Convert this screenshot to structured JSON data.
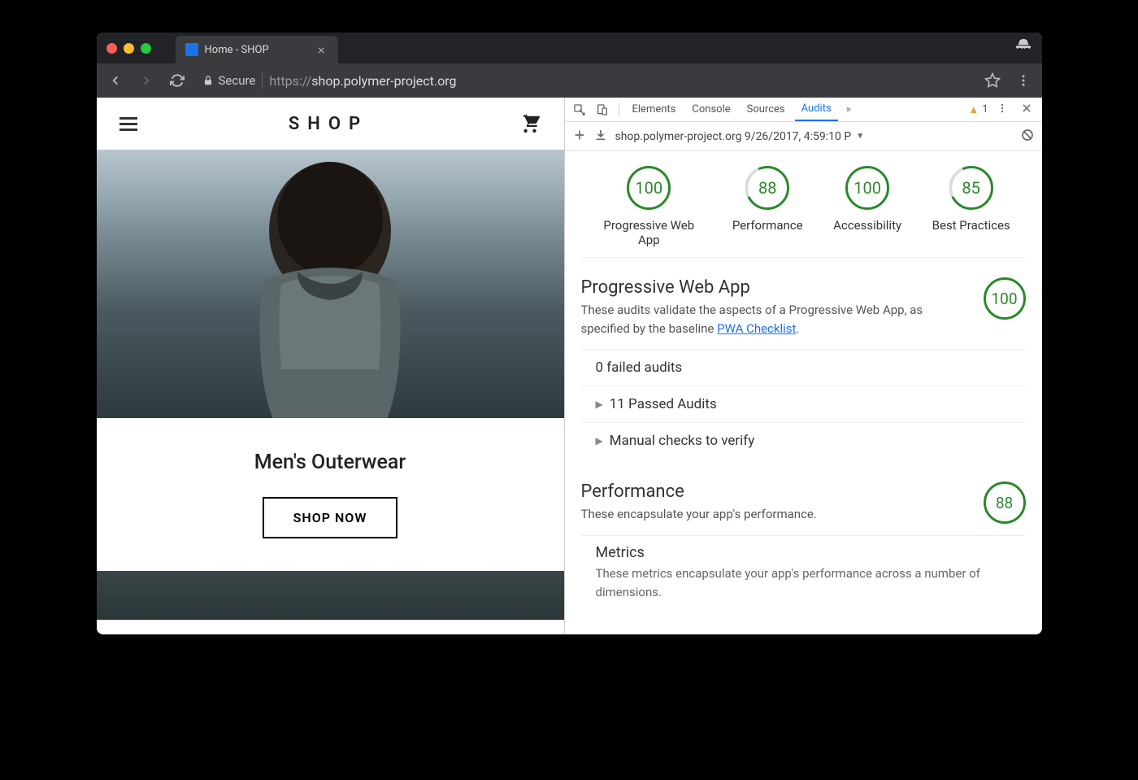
{
  "browser": {
    "tab_title": "Home - SHOP",
    "secure_label": "Secure",
    "url_prefix": "https://",
    "url_host": "shop.polymer-project.org"
  },
  "site": {
    "logo": "SHOP",
    "product_title": "Men's Outerwear",
    "cta": "SHOP NOW"
  },
  "devtools": {
    "tabs": [
      "Elements",
      "Console",
      "Sources",
      "Audits"
    ],
    "active_tab": "Audits",
    "warnings_count": "1",
    "subbar_text": "shop.polymer-project.org 9/26/2017, 4:59:10 P",
    "scores": [
      {
        "value": "100",
        "label": "Progressive Web App",
        "partial": false
      },
      {
        "value": "88",
        "label": "Performance",
        "partial": true
      },
      {
        "value": "100",
        "label": "Accessibility",
        "partial": false
      },
      {
        "value": "85",
        "label": "Best Practices",
        "partial": true
      }
    ],
    "pwa_section": {
      "title": "Progressive Web App",
      "desc1": "These audits validate the aspects of a Progressive Web App, as specified by the baseline ",
      "link": "PWA Checklist",
      "desc2": ".",
      "score": "100",
      "rows": {
        "failed": "0 failed audits",
        "passed": "11 Passed Audits",
        "manual": "Manual checks to verify"
      }
    },
    "perf_section": {
      "title": "Performance",
      "desc": "These encapsulate your app's performance.",
      "score": "88",
      "metrics_title": "Metrics",
      "metrics_desc": "These metrics encapsulate your app's performance across a number of dimensions."
    }
  }
}
